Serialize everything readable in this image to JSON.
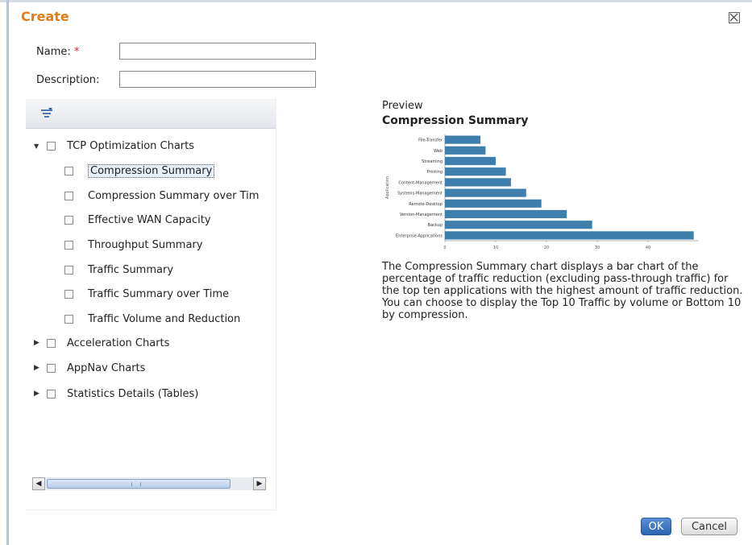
{
  "dialog": {
    "title": "Create"
  },
  "form": {
    "name_label": "Name:",
    "required_mark": "*",
    "name_value": "",
    "description_label": "Description:",
    "description_value": ""
  },
  "tree": {
    "groups": [
      {
        "label": "TCP Optimization Charts",
        "expanded": true,
        "checked": false,
        "children": [
          {
            "label": "Compression Summary",
            "selected": true
          },
          {
            "label": "Compression Summary over Tim"
          },
          {
            "label": "Effective WAN Capacity"
          },
          {
            "label": "Throughput Summary"
          },
          {
            "label": "Traffic Summary"
          },
          {
            "label": "Traffic Summary over Time"
          },
          {
            "label": "Traffic Volume and Reduction"
          }
        ]
      },
      {
        "label": "Acceleration Charts",
        "expanded": false
      },
      {
        "label": "AppNav Charts",
        "expanded": false
      },
      {
        "label": "Statistics Details (Tables)",
        "expanded": false
      }
    ],
    "filter_icon": "filter-icon"
  },
  "preview": {
    "heading": "Preview",
    "title": "Compression Summary",
    "description": "The Compression Summary chart displays a bar chart of the percentage of traffic reduction (excluding pass-through traffic) for the top ten applications with the highest amount of traffic reduction. You can choose to display the Top 10 Traffic by volume or Bottom 10 by compression."
  },
  "chart_data": {
    "type": "bar",
    "orientation": "horizontal",
    "categories": [
      "File-Transfer",
      "Web",
      "Streaming",
      "Printing",
      "Content-Management",
      "Systems-Management",
      "Remote-Desktop",
      "Version-Management",
      "Backup",
      "Enterprise-Applications"
    ],
    "values": [
      7,
      8,
      10,
      12,
      13,
      16,
      19,
      24,
      29,
      49
    ],
    "ylabel": "Application",
    "xticks": [
      0,
      10,
      20,
      30,
      40
    ],
    "xlim": [
      0,
      50
    ],
    "bar_color": "#3f7fae"
  },
  "buttons": {
    "ok": "OK",
    "cancel": "Cancel"
  }
}
